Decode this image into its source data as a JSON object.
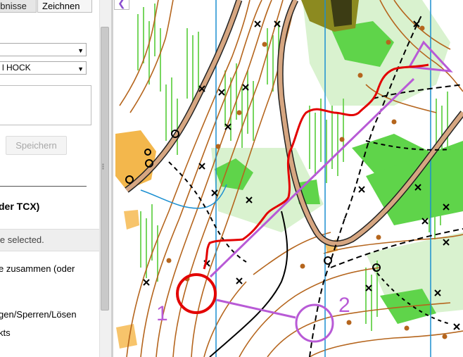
{
  "panel": {
    "tabs": [
      {
        "label": "ebnisse"
      },
      {
        "label": "Zeichnen"
      }
    ],
    "select1": {
      "value": ""
    },
    "select2": {
      "value": "l HOCK"
    },
    "textarea": {
      "value": ""
    },
    "save_label": "Speichern",
    "heading": "der TCX)",
    "status": "le selected.",
    "menu_items": [
      {
        "label": "e zusammen (oder"
      },
      {
        "label": "gen/Sperren/Lösen"
      },
      {
        "label": "kts"
      }
    ]
  },
  "map": {
    "controls": [
      {
        "label": "1"
      },
      {
        "label": "2"
      }
    ],
    "colors": {
      "start_triangle": "#b85ad6",
      "planned_line": "#b85ad6",
      "route": "#e30000",
      "control_1": "#e30000",
      "control_2": "#b85ad6",
      "vegetation": "#5fd44a",
      "contour": "#b5651d",
      "track": "#000000",
      "road_fill": "#d6a681",
      "water": "#1b8fd1"
    }
  }
}
